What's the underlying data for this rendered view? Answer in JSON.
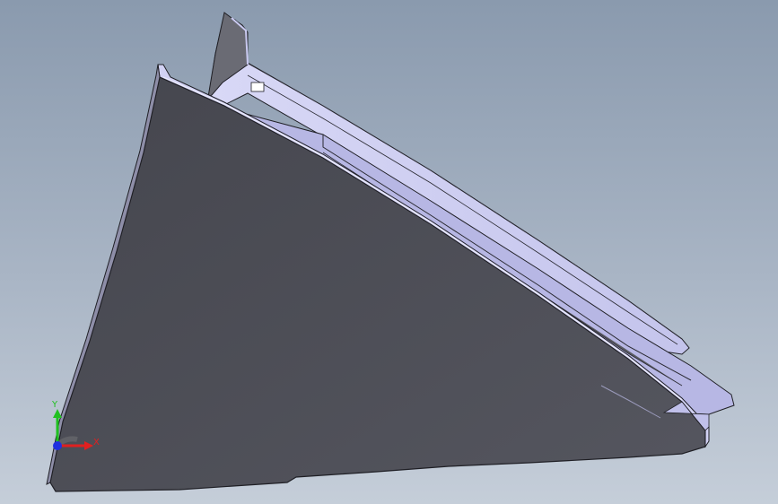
{
  "viewport": {
    "background_top": "#8a9aae",
    "background_bottom": "#c5ced9"
  },
  "model": {
    "main_face_color": "#4f5058",
    "edge_face_color": "#c9c9f0",
    "rail_color": "#dcdcf7",
    "outline_color": "#1f1f25"
  },
  "triad": {
    "x_label": "X",
    "y_label": "Y",
    "x_color": "#e02020",
    "y_color": "#20c020",
    "z_color": "#2030e0"
  }
}
